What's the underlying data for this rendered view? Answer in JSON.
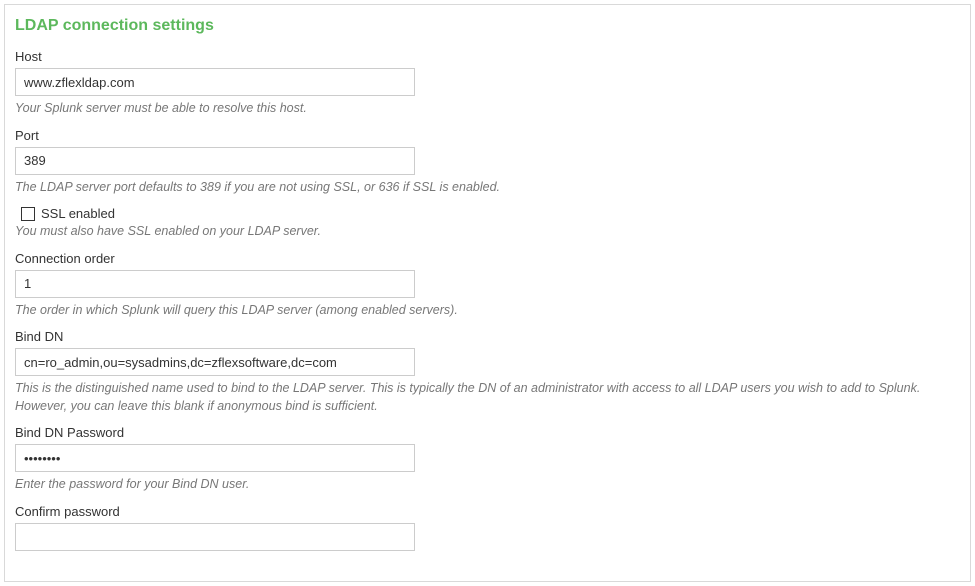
{
  "panel": {
    "title": "LDAP connection settings"
  },
  "fields": {
    "host": {
      "label": "Host",
      "value": "www.zflexldap.com",
      "help": "Your Splunk server must be able to resolve this host."
    },
    "port": {
      "label": "Port",
      "value": "389",
      "help": "The LDAP server port defaults to 389 if you are not using SSL, or 636 if SSL is enabled."
    },
    "ssl": {
      "label": "SSL enabled",
      "checked": false,
      "help": "You must also have SSL enabled on your LDAP server."
    },
    "connection_order": {
      "label": "Connection order",
      "value": "1",
      "help": "The order in which Splunk will query this LDAP server (among enabled servers)."
    },
    "bind_dn": {
      "label": "Bind DN",
      "value": "cn=ro_admin,ou=sysadmins,dc=zflexsoftware,dc=com",
      "help": "This is the distinguished name used to bind to the LDAP server. This is typically the DN of an administrator with access to all LDAP users you wish to add to Splunk. However, you can leave this blank if anonymous bind is sufficient."
    },
    "bind_dn_password": {
      "label": "Bind DN Password",
      "value": "••••••••",
      "help": "Enter the password for your Bind DN user."
    },
    "confirm_password": {
      "label": "Confirm password",
      "value": ""
    }
  }
}
